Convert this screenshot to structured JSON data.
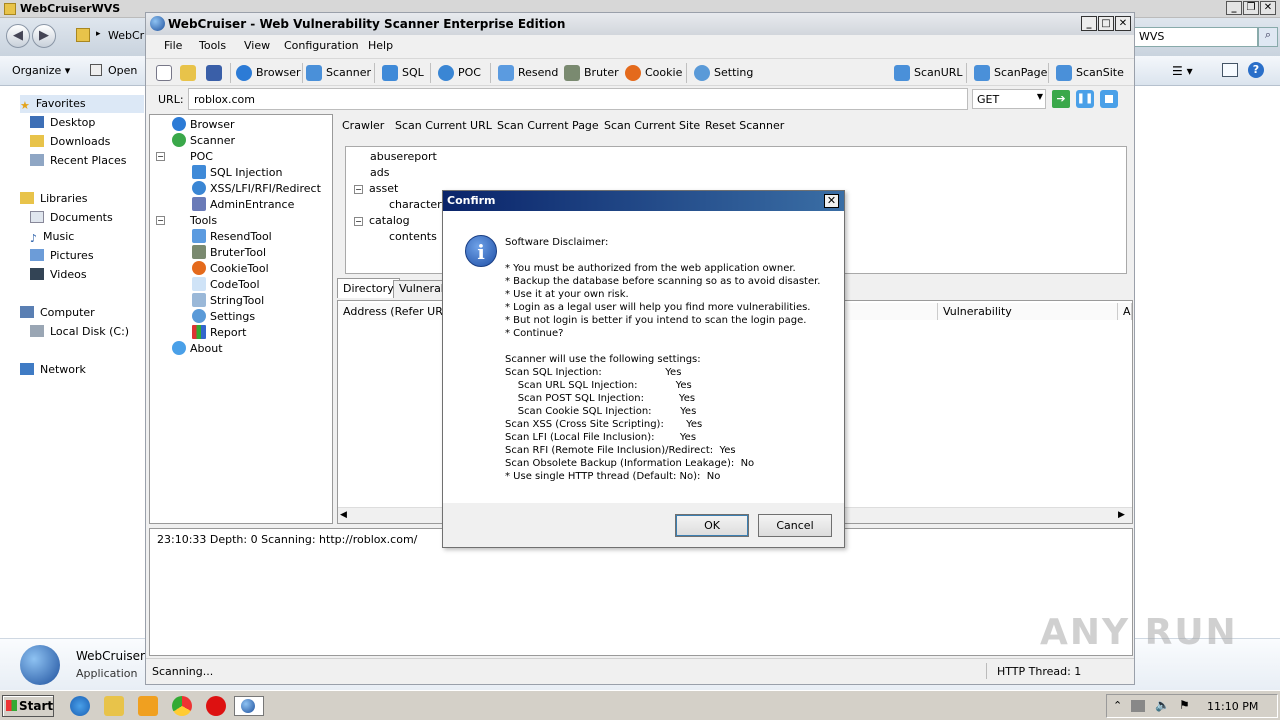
{
  "explorer": {
    "title": "WebCruiserWVS",
    "address_partial": "WebCr",
    "search_partial": "WVS",
    "toolbar": {
      "organize": "Organize",
      "open": "Open"
    },
    "nav": {
      "favorites": "Favorites",
      "desktop": "Desktop",
      "downloads": "Downloads",
      "recent": "Recent Places",
      "libraries": "Libraries",
      "documents": "Documents",
      "music": "Music",
      "pictures": "Pictures",
      "videos": "Videos",
      "computer": "Computer",
      "localdisk": "Local Disk (C:)",
      "network": "Network"
    },
    "details": {
      "name": "WebCruiserV",
      "type": "Application"
    }
  },
  "app": {
    "title": "WebCruiser - Web Vulnerability Scanner Enterprise Edition",
    "menu": [
      "File",
      "Tools",
      "View",
      "Configuration",
      "Help"
    ],
    "toolbar": {
      "browser": "Browser",
      "scanner": "Scanner",
      "sql": "SQL",
      "poc": "POC",
      "resend": "Resend",
      "bruter": "Bruter",
      "cookie": "Cookie",
      "setting": "Setting",
      "scanurl": "ScanURL",
      "scanpage": "ScanPage",
      "scansite": "ScanSite"
    },
    "url": {
      "label": "URL:",
      "value": "roblox.com",
      "method": "GET"
    },
    "tree": {
      "browser": "Browser",
      "scanner": "Scanner",
      "poc": "POC",
      "sqlinjection": "SQL Injection",
      "xss": "XSS/LFI/RFI/Redirect",
      "admin": "AdminEntrance",
      "tools": "Tools",
      "resendtool": "ResendTool",
      "brutertool": "BruterTool",
      "cookietool": "CookieTool",
      "codetool": "CodeTool",
      "stringtool": "StringTool",
      "settings": "Settings",
      "report": "Report",
      "about": "About"
    },
    "scanbar": {
      "crawler": "Crawler",
      "scan_current_url": "Scan Current URL",
      "scan_current_page": "Scan Current Page",
      "scan_current_site": "Scan Current Site",
      "reset_scanner": "Reset Scanner"
    },
    "dirtree": {
      "abusereport": "abusereport",
      "ads": "ads",
      "asset": "asset",
      "characterfe": "characterfe",
      "catalog": "catalog",
      "contents": "contents"
    },
    "tabs": {
      "directory": "Directory",
      "vulnerab": "Vulnerab"
    },
    "columns": {
      "address": "Address (Refer URL",
      "vulnerability": "Vulnerability",
      "a": "A"
    },
    "log": "23:10:33 Depth: 0  Scanning: http://roblox.com/",
    "status": {
      "left": "Scanning...",
      "right": "HTTP Thread: 1"
    }
  },
  "dialog": {
    "title": "Confirm",
    "text": "Software Disclaimer:\n\n* You must be authorized from the web application owner.\n* Backup the database before scanning so as to avoid disaster.\n* Use it at your own risk.\n* Login as a legal user will help you find more vulnerabilities.\n* But not login is better if you intend to scan the login page.\n* Continue?\n\nScanner will use the following settings:\nScan SQL Injection:                    Yes\n    Scan URL SQL Injection:            Yes\n    Scan POST SQL Injection:           Yes\n    Scan Cookie SQL Injection:         Yes\nScan XSS (Cross Site Scripting):       Yes\nScan LFI (Local File Inclusion):        Yes\nScan RFI (Remote File Inclusion)/Redirect:  Yes\nScan Obsolete Backup (Information Leakage):  No\n* Use single HTTP thread (Default: No):  No",
    "ok": "OK",
    "cancel": "Cancel"
  },
  "taskbar": {
    "start": "Start",
    "time": "11:10 PM"
  },
  "watermark": "ANY RUN"
}
